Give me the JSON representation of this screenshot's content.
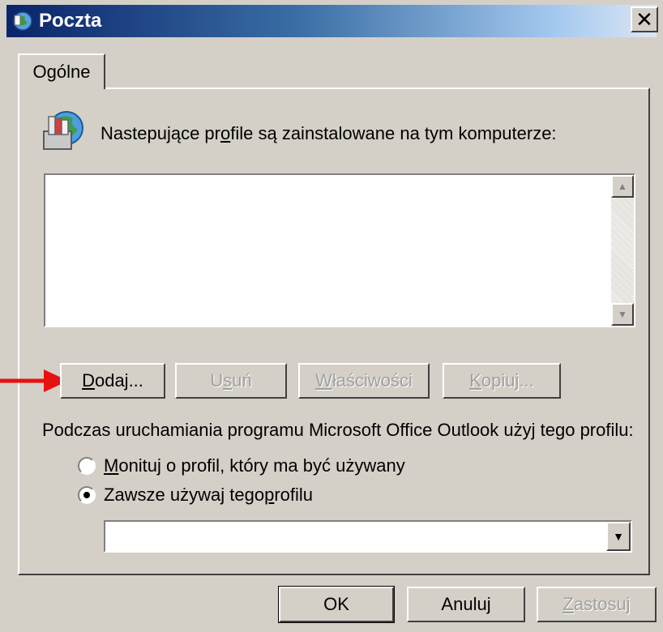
{
  "window": {
    "title": "Poczta",
    "close": "✕"
  },
  "tabs": [
    {
      "label": "Ogólne"
    }
  ],
  "profiles": {
    "label_pre": "Nastepujące pr",
    "label_accel": "o",
    "label_post": "file są zainstalowane na tym komputerze:",
    "items": []
  },
  "buttons": {
    "add": {
      "accel": "D",
      "rest": "odaj..."
    },
    "remove": {
      "pre": "U",
      "accel": "s",
      "rest": "uń"
    },
    "properties": {
      "accel": "W",
      "rest": "łaściwości"
    },
    "copy": {
      "accel": "K",
      "rest": "opiuj..."
    }
  },
  "startup": {
    "label": "Podczas uruchamiania programu Microsoft Office Outlook użyj tego profilu:",
    "prompt_option": {
      "accel": "M",
      "rest": "onituj o profil, który ma być używany",
      "checked": false
    },
    "always_option": {
      "pre": "Zawsze używaj tego ",
      "accel": "p",
      "rest": "rofilu",
      "checked": true
    },
    "selected_profile": ""
  },
  "footer": {
    "ok": "OK",
    "cancel": "Anuluj",
    "apply": {
      "accel": "Z",
      "rest": "astosuj"
    }
  },
  "colors": {
    "titlebar_start": "#0a246a",
    "arrow": "#e81010",
    "face": "#d4d0c8"
  }
}
